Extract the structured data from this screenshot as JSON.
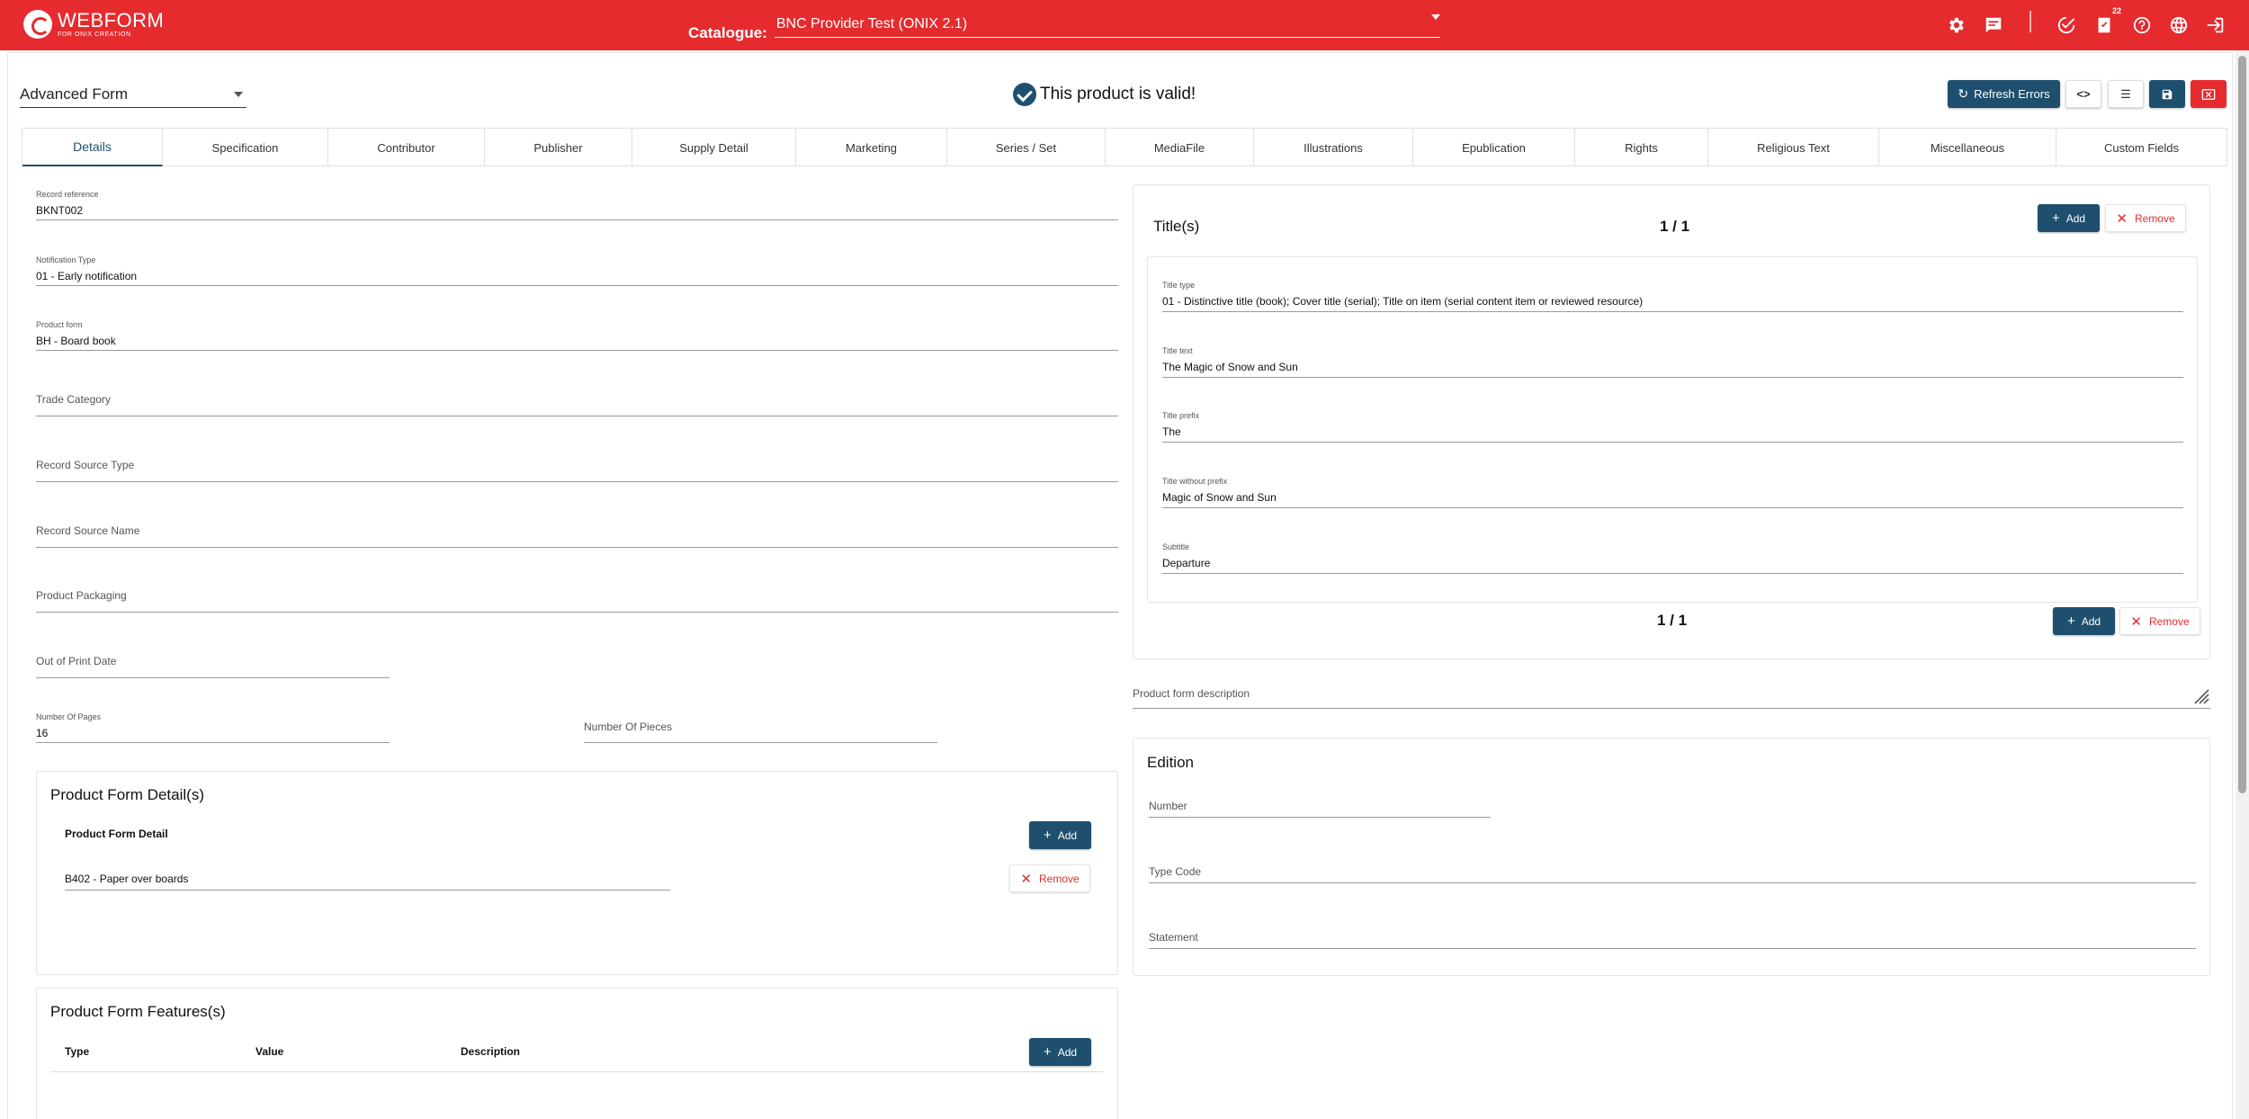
{
  "topbar": {
    "logo_name": "WEBFORM",
    "logo_sub": "FOR ONIX CREATION",
    "catalogue_label": "Catalogue:",
    "catalogue_value": "BNC Provider Test (ONIX 2.1)",
    "task_badge": "22",
    "icons": [
      "gear-icon",
      "chat-icon",
      "check-circle-icon",
      "task-icon",
      "help-icon",
      "globe-icon",
      "exit-icon"
    ],
    "color": "#e52b2e"
  },
  "toolbar": {
    "form_mode": "Advanced Form",
    "valid_message": "This product is valid!",
    "refresh_label": "Refresh Errors",
    "accent": "#1e4f6e"
  },
  "tabs": [
    {
      "label": "Details"
    },
    {
      "label": "Specification"
    },
    {
      "label": "Contributor"
    },
    {
      "label": "Publisher"
    },
    {
      "label": "Supply Detail"
    },
    {
      "label": "Marketing"
    },
    {
      "label": "Series / Set"
    },
    {
      "label": "MediaFile"
    },
    {
      "label": "Illustrations"
    },
    {
      "label": "Epublication"
    },
    {
      "label": "Rights"
    },
    {
      "label": "Religious Text"
    },
    {
      "label": "Miscellaneous"
    },
    {
      "label": "Custom Fields"
    }
  ],
  "details": {
    "record_reference_label": "Record reference",
    "record_reference": "BKNT002",
    "notification_type_label": "Notification Type",
    "notification_type": "01 - Early notification",
    "product_form_label": "Product form",
    "product_form": "BH - Board book",
    "trade_category": "Trade Category",
    "record_source_type": "Record Source Type",
    "record_source_name": "Record Source Name",
    "product_packaging": "Product Packaging",
    "out_of_print_date": "Out of Print Date",
    "number_of_pages_label": "Number Of Pages",
    "number_of_pages": "16",
    "number_of_pieces": "Number Of Pieces"
  },
  "product_form_details": {
    "title": "Product Form Detail(s)",
    "subtitle": "Product Form Detail",
    "value": "B402 - Paper over boards",
    "add_label": "Add",
    "remove_label": "Remove"
  },
  "product_form_features": {
    "title": "Product Form Features(s)",
    "columns": [
      "Type",
      "Value",
      "Description"
    ],
    "add_label": "Add"
  },
  "titles": {
    "title": "Title(s)",
    "counter": "1 / 1",
    "add_label": "Add",
    "remove_label": "Remove",
    "title_type_label": "Title type",
    "title_type": "01 - Distinctive title (book); Cover title (serial); Title on item (serial content item or reviewed resource)",
    "title_text_label": "Title text",
    "title_text": "The Magic of Snow and Sun",
    "title_prefix_label": "Title prefix",
    "title_prefix": "The",
    "title_without_prefix_label": "Title without prefix",
    "title_without_prefix": "Magic of Snow and Sun",
    "subtitle_label": "Subtitle",
    "subtitle": "Departure"
  },
  "product_form_description": "Product form description",
  "edition": {
    "title": "Edition",
    "number": "Number",
    "type_code": "Type Code",
    "statement": "Statement"
  }
}
